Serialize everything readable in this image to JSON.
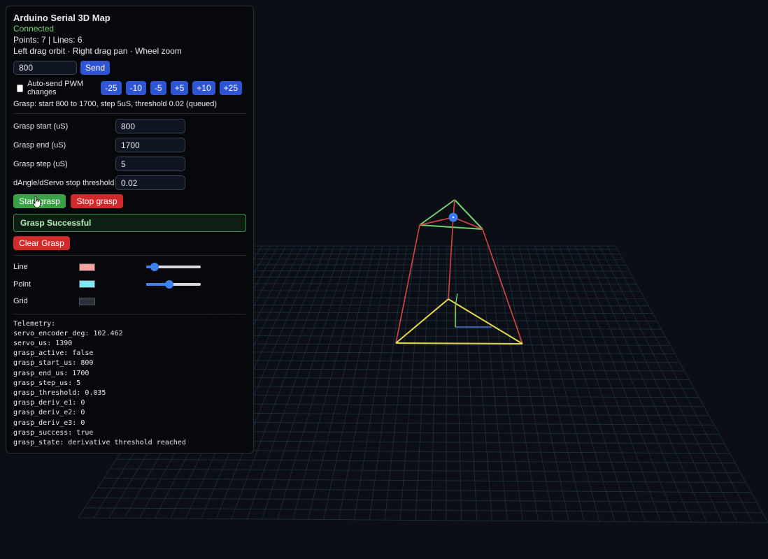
{
  "panel": {
    "title": "Arduino Serial 3D Map",
    "status": "Connected",
    "counts": "Points: 7 | Lines: 6",
    "controls_hint": "Left drag orbit · Right drag pan · Wheel zoom",
    "pwm_value": "800",
    "send_label": "Send",
    "autosend_label": "Auto-send PWM changes",
    "autosend_checked": false,
    "steps": [
      "-25",
      "-10",
      "-5",
      "+5",
      "+10",
      "+25"
    ],
    "grasp_info": "Grasp: start 800 to 1700, step 5uS, threshold 0.02 (queued)",
    "fields": [
      {
        "label": "Grasp start (uS)",
        "value": "800"
      },
      {
        "label": "Grasp end (uS)",
        "value": "1700"
      },
      {
        "label": "Grasp step (uS)",
        "value": "5"
      },
      {
        "label": "dAngle/dServo stop threshold",
        "value": "0.02"
      }
    ],
    "start_grasp": "Start grasp",
    "stop_grasp": "Stop grasp",
    "grasp_result": "Grasp Successful",
    "clear_grasp": "Clear Grasp",
    "colors": [
      {
        "label": "Line",
        "color": "#f4a3a3",
        "slider": 0.15
      },
      {
        "label": "Point",
        "color": "#7ee8f4",
        "slider": 0.42
      },
      {
        "label": "Grid",
        "color": "#2a313d"
      }
    ],
    "telemetry_header": "Telemetry:",
    "telemetry": [
      "servo_encoder_deg: 102.462",
      "servo_us: 1390",
      "grasp_active: false",
      "grasp_start_us: 800",
      "grasp_end_us: 1700",
      "grasp_step_us: 5",
      "grasp_threshold: 0.035",
      "grasp_deriv_e1: 0",
      "grasp_deriv_e2: 0",
      "grasp_deriv_e3: 0",
      "grasp_success: true",
      "grasp_state: derivative threshold reached"
    ]
  },
  "scene_colors": {
    "background": "#0b0e14",
    "grid": "#1f3a4a",
    "edge_red": "#d84545",
    "edge_green": "#6ed36e",
    "edge_yellow": "#e6d84a",
    "axis_blue": "#4a78d8",
    "point": "#3d7cf0"
  }
}
